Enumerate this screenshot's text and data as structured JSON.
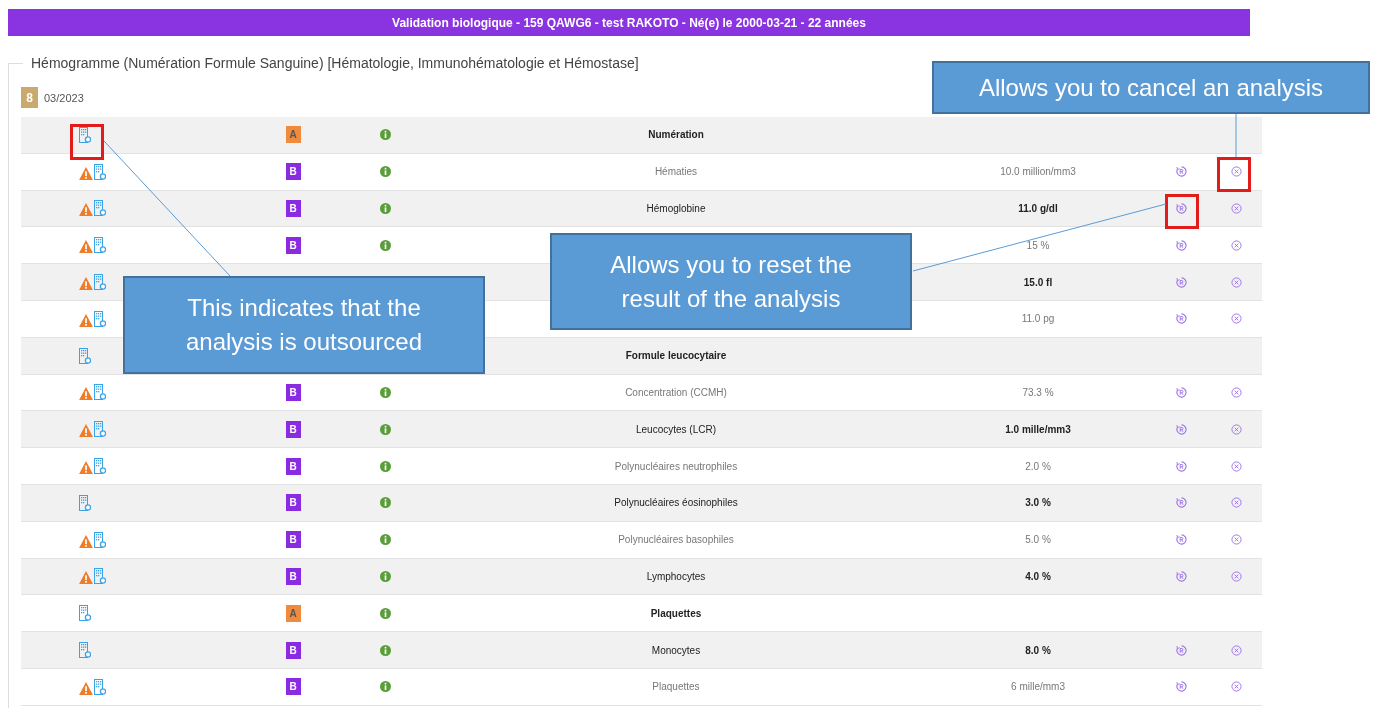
{
  "header": {
    "title": "Validation biologique - 159 QAWG6 - test RAKOTO - Né(e) le 2000-03-21 - 22 années"
  },
  "section": {
    "legend": "Hémogramme (Numération Formule Sanguine) [Hématologie, Immunohématologie et Hémostase]",
    "count": "8",
    "date": "03/2023"
  },
  "rows": [
    {
      "kind": "group",
      "name": "Numération",
      "warning": false,
      "badge": "A",
      "color": "#f08a3c"
    },
    {
      "kind": "test",
      "name": "Hématies",
      "warning": true,
      "badge": "B",
      "color": "#8a2be2",
      "value": "10.0 million/mm3"
    },
    {
      "kind": "test",
      "name": "Hémoglobine",
      "warning": true,
      "badge": "B",
      "color": "#8a2be2",
      "value": "11.0 g/dl"
    },
    {
      "kind": "test",
      "warning": true,
      "badge": "B",
      "color": "#8a2be2",
      "value": "15 %"
    },
    {
      "kind": "test",
      "warning": true,
      "value": "15.0 fl"
    },
    {
      "kind": "test",
      "warning": true,
      "value": "11.0 pg"
    },
    {
      "kind": "group",
      "name": "Formule leucocytaire",
      "warning": false
    },
    {
      "kind": "test",
      "name": "Concentration (CCMH)",
      "warning": true,
      "badge": "B",
      "color": "#8a2be2",
      "value": "73.3 %"
    },
    {
      "kind": "test",
      "name": "Leucocytes (LCR)",
      "warning": true,
      "badge": "B",
      "color": "#8a2be2",
      "value": "1.0 mille/mm3"
    },
    {
      "kind": "test",
      "name": "Polynucléaires neutrophiles",
      "warning": true,
      "badge": "B",
      "color": "#8a2be2",
      "value": "2.0 %"
    },
    {
      "kind": "test",
      "name": "Polynucléaires éosinophiles",
      "warning": false,
      "badge": "B",
      "color": "#8a2be2",
      "value": "3.0 %"
    },
    {
      "kind": "test",
      "name": "Polynucléaires basophiles",
      "warning": true,
      "badge": "B",
      "color": "#8a2be2",
      "value": "5.0 %"
    },
    {
      "kind": "test",
      "name": "Lymphocytes",
      "warning": true,
      "badge": "B",
      "color": "#8a2be2",
      "value": "4.0 %"
    },
    {
      "kind": "group",
      "name": "Plaquettes",
      "warning": false,
      "badge": "A",
      "color": "#f08a3c"
    },
    {
      "kind": "test",
      "name": "Monocytes",
      "warning": false,
      "badge": "B",
      "color": "#8a2be2",
      "value": "8.0 %"
    },
    {
      "kind": "test",
      "name": "Plaquettes",
      "warning": true,
      "badge": "B",
      "color": "#8a2be2",
      "value": "6 mille/mm3"
    }
  ],
  "callouts": [
    {
      "kind": "outsourced",
      "text": "This indicates that the analysis is outsourced"
    },
    {
      "kind": "reset",
      "text": "Allows you to reset the result of the analysis"
    },
    {
      "kind": "cancel",
      "text": "Allows you to cancel an analysis"
    }
  ]
}
